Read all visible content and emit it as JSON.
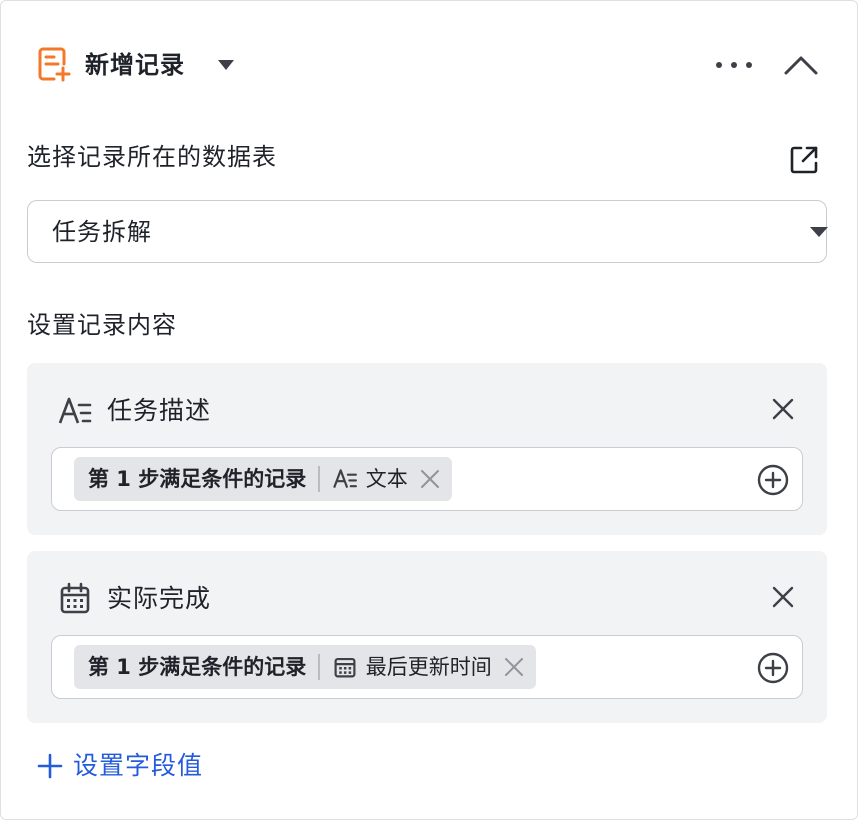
{
  "header": {
    "title": "新增记录"
  },
  "table_section": {
    "label": "选择记录所在的数据表",
    "selected_table": "任务拆解"
  },
  "content_section": {
    "label": "设置记录内容",
    "fields": [
      {
        "name": "任务描述",
        "type_icon": "text-field-icon",
        "source": "第 1 步满足条件的记录",
        "source_field": "文本",
        "source_field_icon": "text-field-icon"
      },
      {
        "name": "实际完成",
        "type_icon": "calendar-icon",
        "source": "第 1 步满足条件的记录",
        "source_field": "最后更新时间",
        "source_field_icon": "calendar-icon"
      }
    ],
    "add_field_label": "设置字段值"
  },
  "colors": {
    "accent": "#245bdb",
    "node_icon": "#f5782a",
    "card_bg": "#f2f3f5",
    "chip_bg": "#e4e5e8",
    "border": "#c9ccd1"
  }
}
